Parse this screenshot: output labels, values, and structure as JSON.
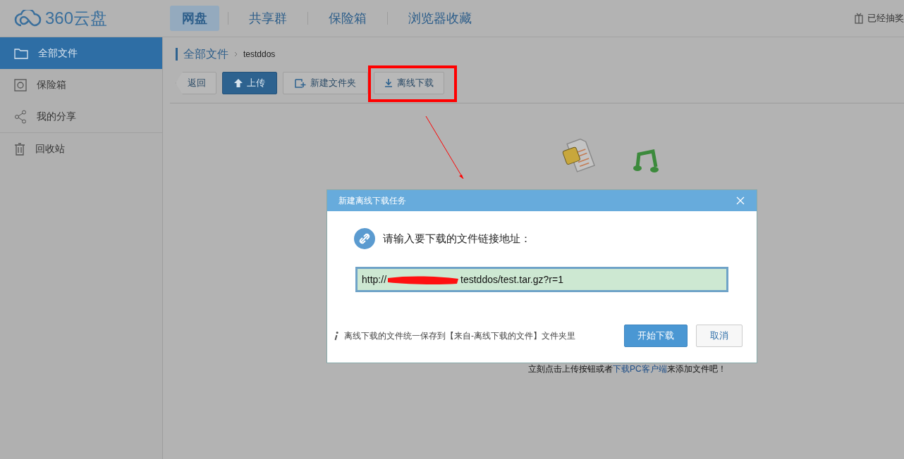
{
  "header": {
    "logo": "360云盘",
    "tabs": [
      {
        "label": "网盘",
        "selected": true
      },
      {
        "label": "共享群",
        "selected": false
      },
      {
        "label": "保险箱",
        "selected": false
      },
      {
        "label": "浏览器收藏",
        "selected": false
      }
    ],
    "lottery": "已经抽奖"
  },
  "sidebar": {
    "items": [
      {
        "label": "全部文件",
        "kind": "folder",
        "selected": true
      },
      {
        "label": "保险箱",
        "kind": "safe",
        "selected": false
      },
      {
        "label": "我的分享",
        "kind": "share",
        "selected": false
      },
      {
        "label": "回收站",
        "kind": "trash",
        "selected": false
      }
    ]
  },
  "breadcrumb": {
    "root": "全部文件",
    "current": "testddos"
  },
  "toolbar": [
    {
      "label": "返回",
      "kind": "back"
    },
    {
      "label": "上传",
      "kind": "primary"
    },
    {
      "label": "新建文件夹",
      "kind": "folder"
    },
    {
      "label": "离线下载",
      "kind": "download"
    }
  ],
  "empty_hint": {
    "before": "立刻点击上传按钮或者",
    "link": "下载PC客户端",
    "after": "来添加文件吧！"
  },
  "dialog": {
    "title": "新建离线下载任务",
    "prompt": "请输入要下载的文件链接地址：",
    "url_start": "http://",
    "url_end": "testddos/test.tar.gz?r=1",
    "note": "离线下载的文件统一保存到【来自-离线下载的文件】文件夹里",
    "buttons": [
      {
        "label": "开始下载",
        "kind": "primary"
      },
      {
        "label": "取消",
        "kind": "secondary"
      }
    ]
  }
}
